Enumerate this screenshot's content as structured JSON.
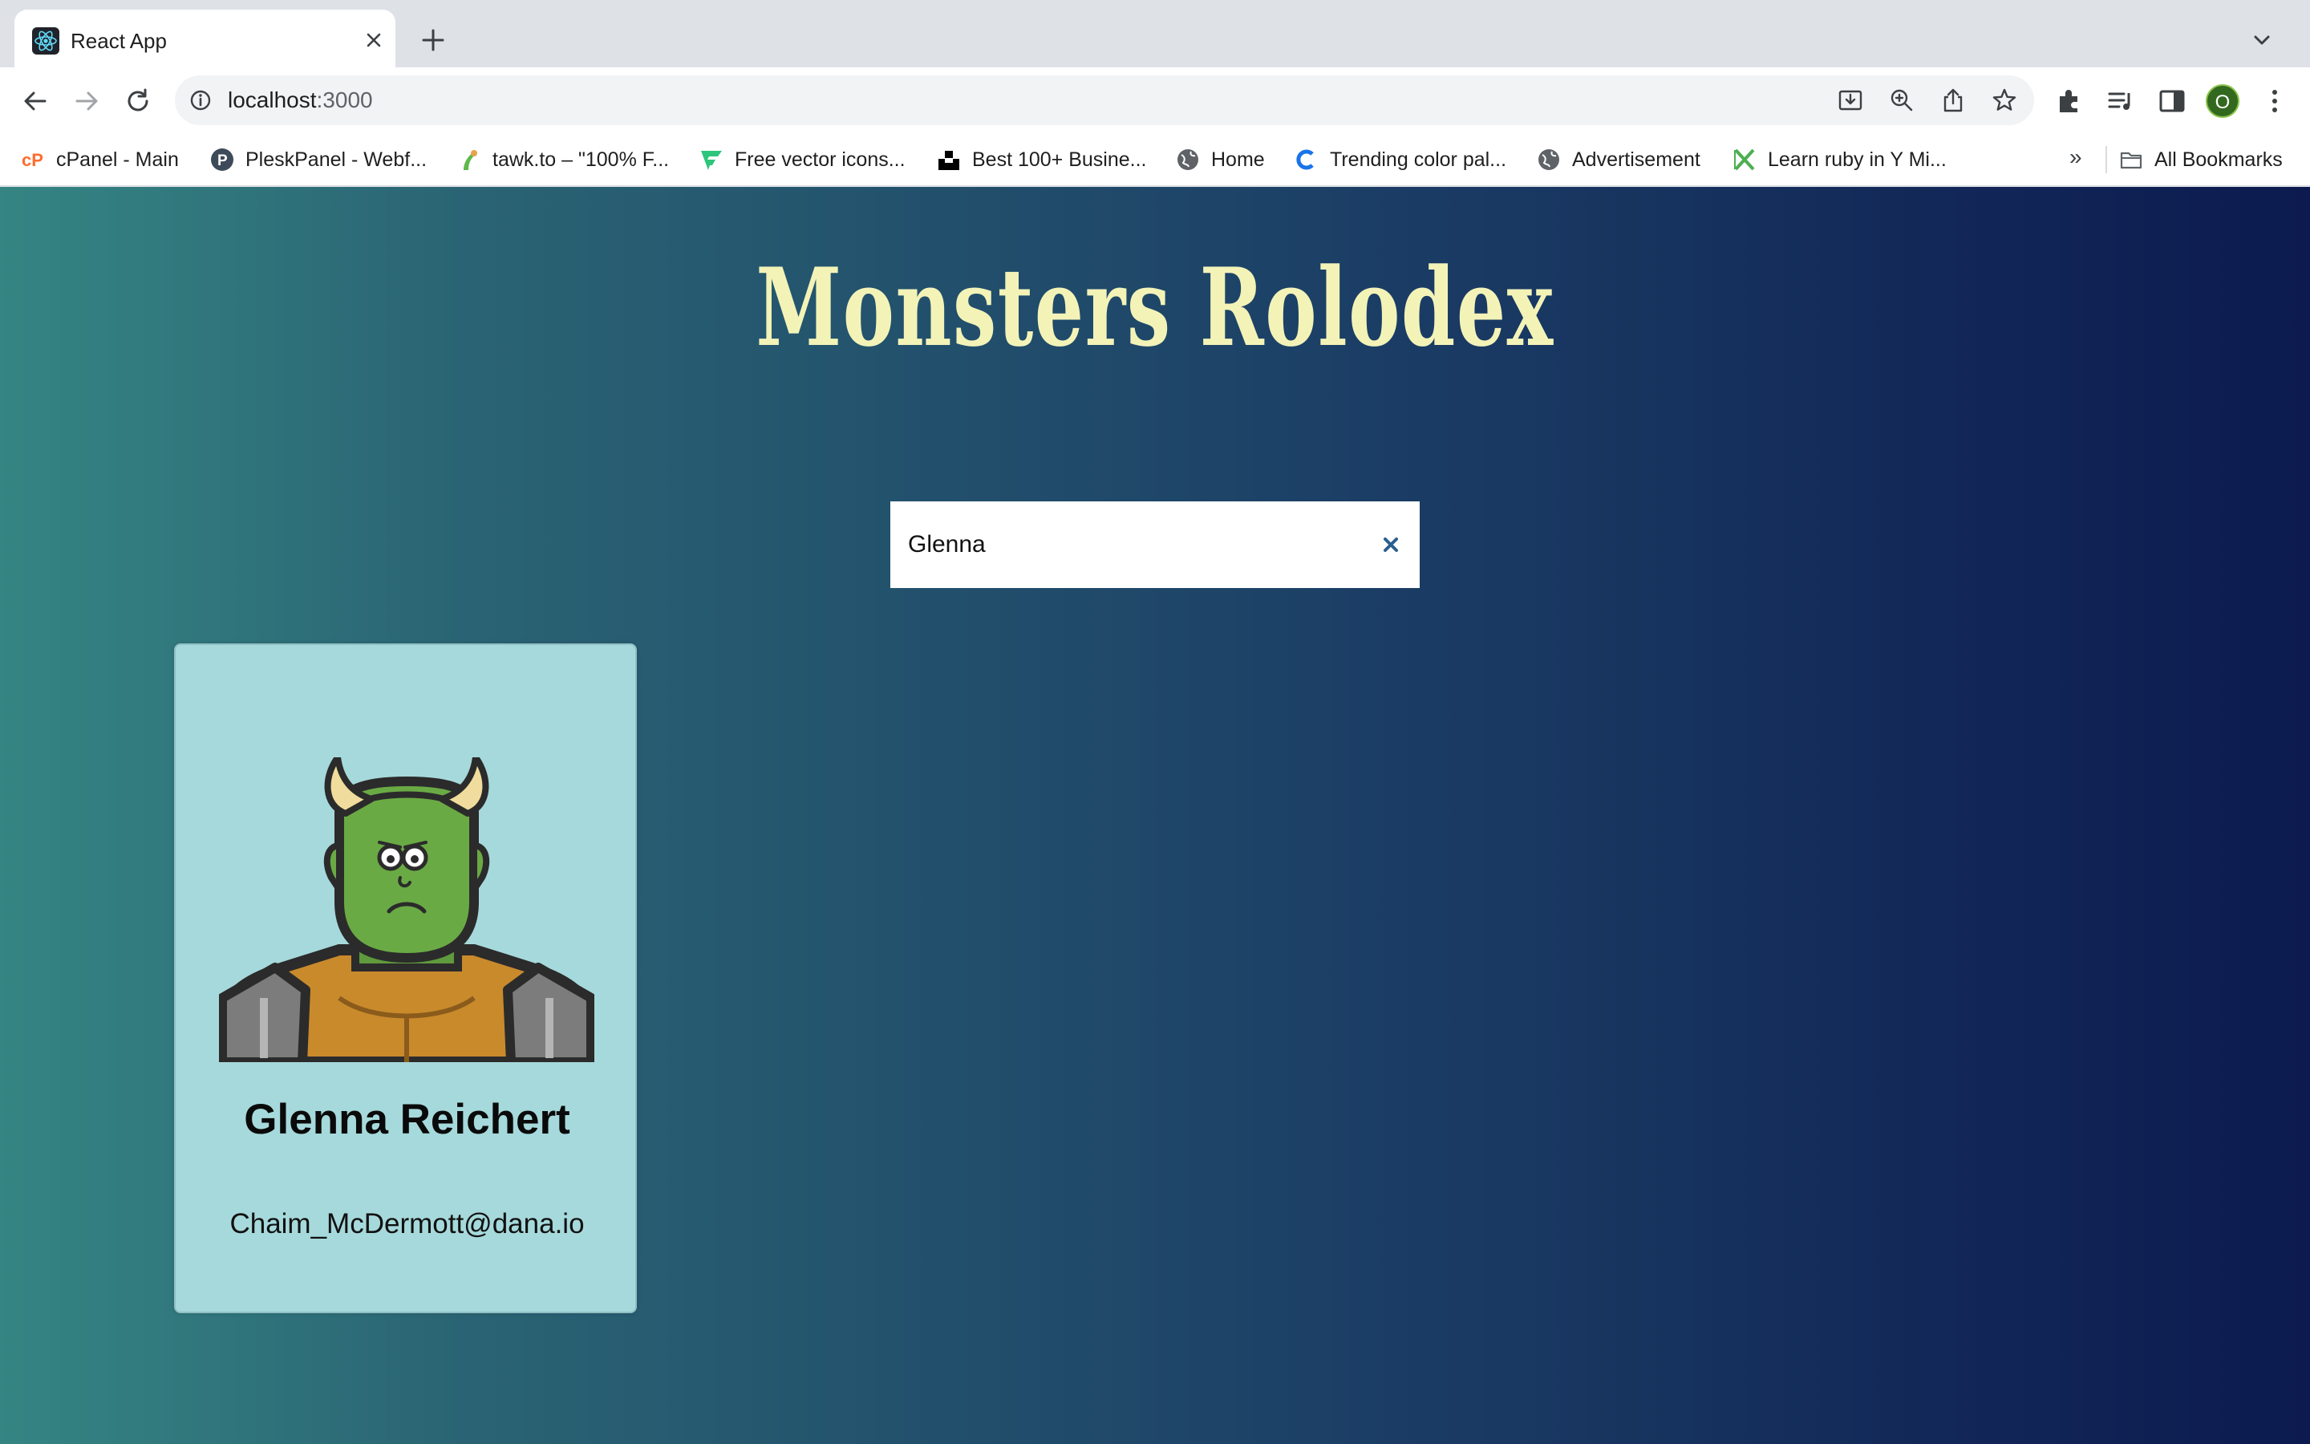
{
  "browser": {
    "tab": {
      "title": "React App",
      "favicon": "react-icon"
    },
    "address": {
      "host": "localhost",
      "port": ":3000"
    },
    "profile_initial": "O",
    "bookmarks": [
      {
        "label": "cPanel - Main",
        "icon": "cpanel-icon"
      },
      {
        "label": "PleskPanel - Webf...",
        "icon": "plesk-icon"
      },
      {
        "label": "tawk.to – \"100% F...",
        "icon": "tawk-icon"
      },
      {
        "label": "Free vector icons...",
        "icon": "flaticon-icon"
      },
      {
        "label": "Best 100+ Busine...",
        "icon": "unsplash-icon"
      },
      {
        "label": "Home",
        "icon": "globe-icon"
      },
      {
        "label": "Trending color pal...",
        "icon": "coolors-icon"
      },
      {
        "label": "Advertisement",
        "icon": "globe-icon"
      },
      {
        "label": "Learn ruby in Y Mi...",
        "icon": "learnx-icon"
      }
    ],
    "bookmarks_overflow": "»",
    "all_bookmarks": "All Bookmarks"
  },
  "app": {
    "title": "Monsters Rolodex",
    "search": {
      "value": "Glenna",
      "placeholder": "search monsters"
    },
    "monsters": [
      {
        "name": "Glenna Reichert",
        "email": "Chaim_McDermott@dana.io",
        "avatar": "monster-avatar"
      }
    ]
  },
  "colors": {
    "title": "#f3f3b8",
    "card_bg": "#a6d9db",
    "gradient_start": "#358583",
    "gradient_end": "#0c1a4f",
    "clear_icon": "#2a5f8f"
  }
}
